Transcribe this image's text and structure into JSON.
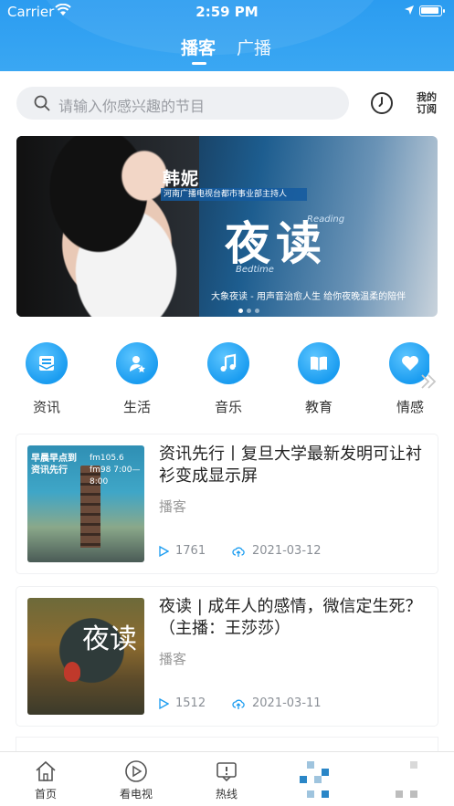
{
  "status_bar": {
    "carrier": "Carrier",
    "time": "2:59 PM"
  },
  "header": {
    "tabs": [
      {
        "label": "播客",
        "active": true
      },
      {
        "label": "广播",
        "active": false
      }
    ]
  },
  "search": {
    "placeholder": "请输入你感兴趣的节目"
  },
  "my_subscription_label": "我的订阅",
  "banner": {
    "name": "韩妮",
    "host_title": "河南广播电视台都市事业部主持人",
    "title": "夜读",
    "reading": "Reading",
    "bedtime": "Bedtime",
    "slogan": "大象夜读 - 用声音治愈人生 给你夜晚温柔的陪伴"
  },
  "categories": [
    {
      "label": "资讯",
      "icon": "news-icon"
    },
    {
      "label": "生活",
      "icon": "person-star-icon"
    },
    {
      "label": "音乐",
      "icon": "music-note-icon"
    },
    {
      "label": "教育",
      "icon": "book-icon"
    },
    {
      "label": "情感",
      "icon": "heart-icon"
    }
  ],
  "programs": [
    {
      "title": "资讯先行丨复旦大学最新发明可让衬衫变成显示屏",
      "author": "播客",
      "plays": "1761",
      "date": "2021-03-12",
      "thumb_text_left": "早晨早点到 资讯先行",
      "thumb_text_right": "fm105.6 fm98 7:00—8:00"
    },
    {
      "title": "夜读 | 成年人的感情，微信定生死？（主播：王莎莎）",
      "author": "播客",
      "plays": "1512",
      "date": "2021-03-11",
      "thumb_text": "夜读"
    }
  ],
  "tabbar": [
    {
      "label": "首页",
      "icon": "home-icon"
    },
    {
      "label": "看电视",
      "icon": "play-circle-icon"
    },
    {
      "label": "热线",
      "icon": "hotline-icon"
    }
  ],
  "colors": {
    "accent": "#1a9cf0",
    "header_bg": "#2b9cf0"
  }
}
